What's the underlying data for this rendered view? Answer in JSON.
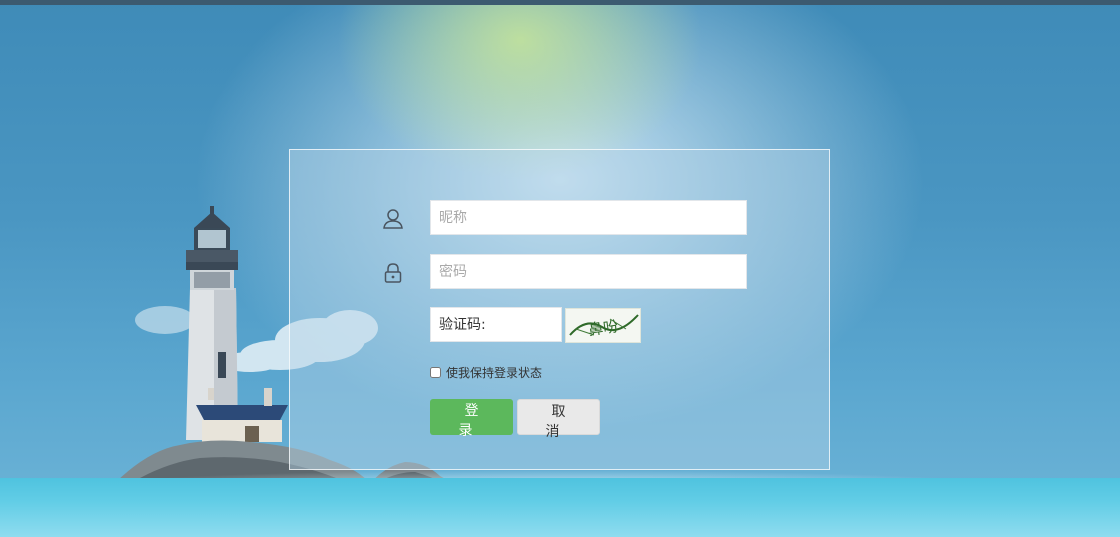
{
  "form": {
    "nickname_placeholder": "昵称",
    "password_placeholder": "密码",
    "captcha_placeholder": "验证码:",
    "captcha_text": "鼻吩",
    "remember_label": "使我保持登录状态",
    "login_label": "登 录",
    "cancel_label": "取 消"
  },
  "icons": {
    "user": "user-icon",
    "lock": "lock-icon"
  },
  "colors": {
    "login_button": "#5cb85c",
    "cancel_button": "#e9e9e9",
    "panel_border": "#ffffff"
  }
}
